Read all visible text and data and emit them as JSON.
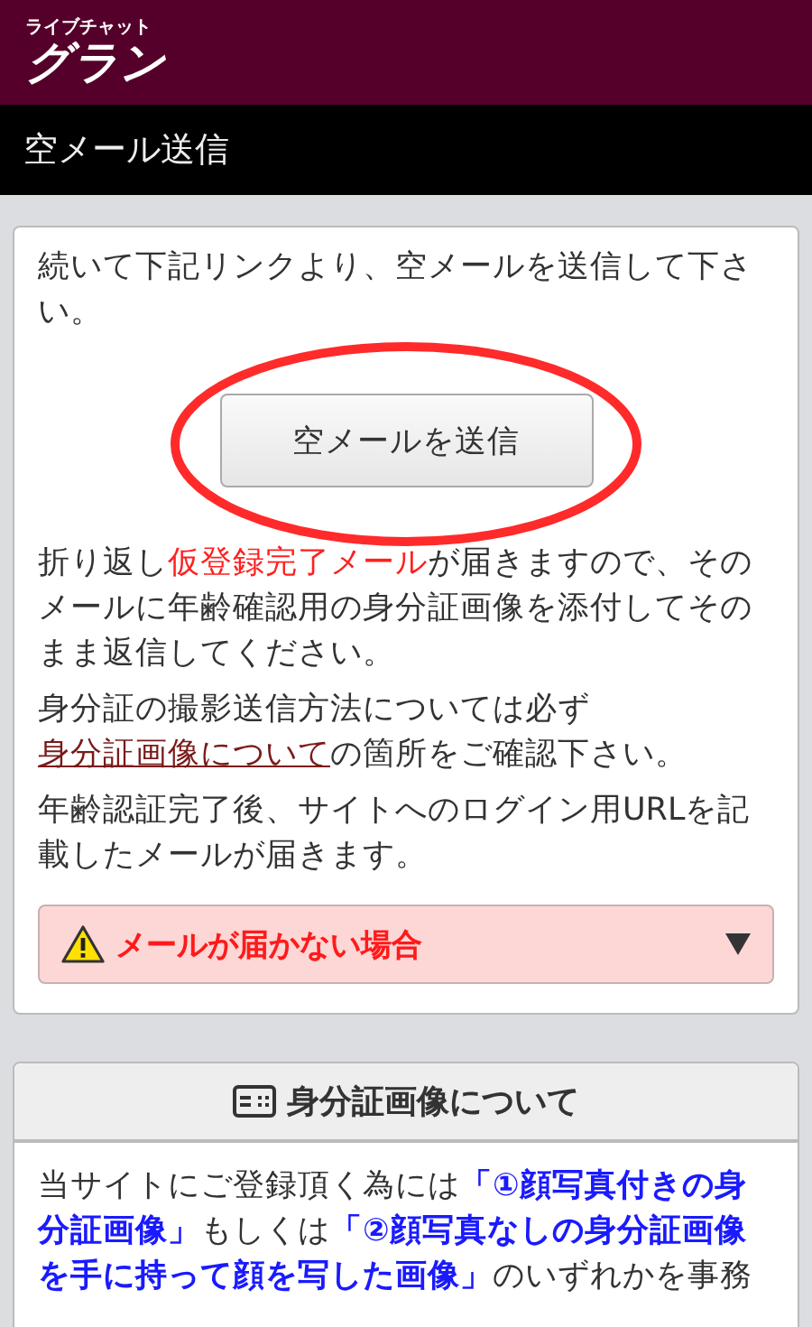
{
  "header": {
    "logo_small": "ライブチャット",
    "logo_large": "グラン"
  },
  "page_title": "空メール送信",
  "send_card": {
    "intro": "続いて下記リンクより、空メールを送信して下さい。",
    "button": "空メールを送信",
    "paragraphs": [
      [
        {
          "kind": "plain",
          "text": "折り返し"
        },
        {
          "kind": "highlight",
          "text": "仮登録完了メール"
        },
        {
          "kind": "plain",
          "text": "が届きますので、そのメールに年齢確認用の身分証画像を添付してそのまま返信してください。"
        }
      ],
      [
        {
          "kind": "plain",
          "text": "身分証の撮影送信方法については必ず"
        },
        {
          "kind": "link",
          "text": "身分証画像について"
        },
        {
          "kind": "plain",
          "text": "の箇所をご確認下さい。"
        }
      ],
      [
        {
          "kind": "plain",
          "text": "年齢認証完了後、サイトへのログイン用URLを記載したメールが届きます。"
        }
      ]
    ],
    "accordion": {
      "label": "メールが届かない場合",
      "expanded": false
    }
  },
  "id_card": {
    "title": "身分証画像について",
    "paragraph": [
      {
        "kind": "plain",
        "text": "当サイトにご登録頂く為には"
      },
      {
        "kind": "emphasis",
        "text": "「①顔写真付きの身分証画像」"
      },
      {
        "kind": "plain",
        "text": "もしくは"
      },
      {
        "kind": "emphasis",
        "text": "「②顔写真なしの身分証画像を手に持って顔を写した画像」"
      },
      {
        "kind": "plain",
        "text": "のいずれかを事務"
      }
    ]
  }
}
